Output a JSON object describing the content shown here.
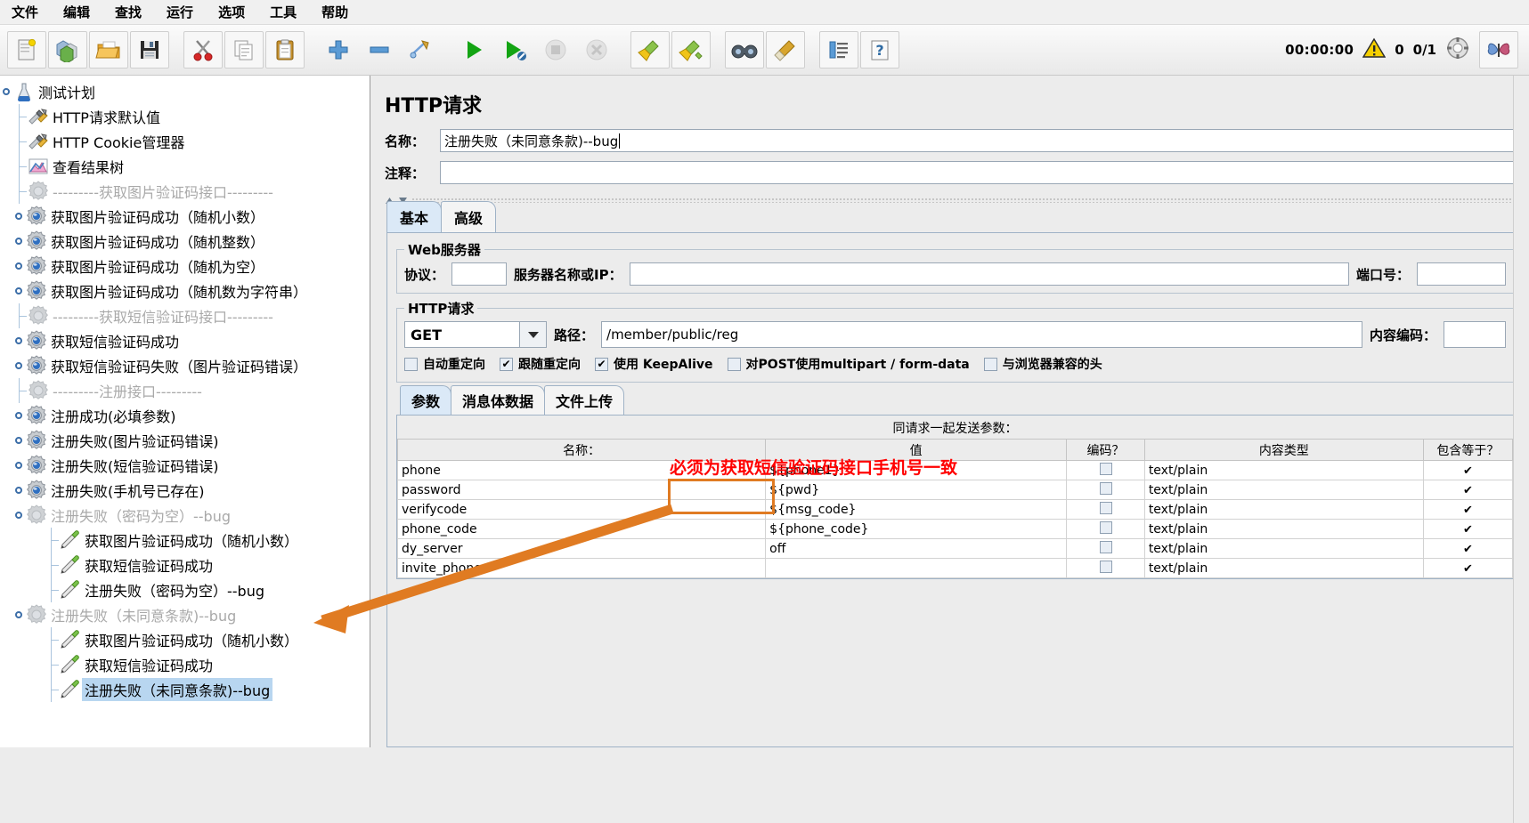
{
  "menu": {
    "items": [
      "文件",
      "编辑",
      "查找",
      "运行",
      "选项",
      "工具",
      "帮助"
    ]
  },
  "toolbar": {
    "buttons": [
      {
        "name": "new",
        "icon": "new-file-icon"
      },
      {
        "name": "templates",
        "icon": "templates-icon"
      },
      {
        "name": "open",
        "icon": "open-folder-icon"
      },
      {
        "name": "save",
        "icon": "save-disk-icon"
      },
      {
        "name": "cut",
        "icon": "scissors-icon"
      },
      {
        "name": "copy",
        "icon": "copy-icon"
      },
      {
        "name": "paste",
        "icon": "clipboard-icon"
      },
      {
        "name": "expand",
        "icon": "plus-icon"
      },
      {
        "name": "collapse",
        "icon": "minus-icon"
      },
      {
        "name": "toggle",
        "icon": "toggle-icon"
      },
      {
        "name": "start",
        "icon": "play-icon"
      },
      {
        "name": "start-no-pauses",
        "icon": "play-no-pause-icon"
      },
      {
        "name": "stop",
        "icon": "stop-icon"
      },
      {
        "name": "shutdown",
        "icon": "shutdown-icon"
      },
      {
        "name": "clear",
        "icon": "broom-icon"
      },
      {
        "name": "clear-all",
        "icon": "broom-all-icon"
      },
      {
        "name": "search",
        "icon": "binoculars-icon"
      },
      {
        "name": "reset-search",
        "icon": "eraser-icon"
      },
      {
        "name": "function-helper",
        "icon": "function-list-icon"
      },
      {
        "name": "help",
        "icon": "help-icon"
      }
    ],
    "status": {
      "elapsed": "00:00:00",
      "warning_count": "0",
      "threads": "0/1",
      "warning_icon": "warning-triangle-icon",
      "thread-icon": "thread-indicator-icon",
      "bug_icon": "butterfly-icon"
    }
  },
  "tree": {
    "nodes": [
      {
        "label": "测试计划",
        "depth": 0,
        "icon": "test-plan-icon",
        "handle": true,
        "disabled": false,
        "selected": false
      },
      {
        "label": "HTTP请求默认值",
        "depth": 1,
        "icon": "config-element-icon",
        "handle": false,
        "disabled": false,
        "selected": false
      },
      {
        "label": "HTTP Cookie管理器",
        "depth": 1,
        "icon": "config-element-icon",
        "handle": false,
        "disabled": false,
        "selected": false
      },
      {
        "label": "查看结果树",
        "depth": 1,
        "icon": "view-results-tree-icon",
        "handle": false,
        "disabled": false,
        "selected": false
      },
      {
        "label": "---------获取图片验证码接口---------",
        "depth": 1,
        "icon": "thread-group-disabled-icon",
        "handle": false,
        "disabled": true,
        "selected": false
      },
      {
        "label": "获取图片验证码成功（随机小数）",
        "depth": 1,
        "icon": "thread-group-icon",
        "handle": true,
        "disabled": false,
        "selected": false
      },
      {
        "label": "获取图片验证码成功（随机整数）",
        "depth": 1,
        "icon": "thread-group-icon",
        "handle": true,
        "disabled": false,
        "selected": false
      },
      {
        "label": "获取图片验证码成功（随机为空）",
        "depth": 1,
        "icon": "thread-group-icon",
        "handle": true,
        "disabled": false,
        "selected": false
      },
      {
        "label": "获取图片验证码成功（随机数为字符串）",
        "depth": 1,
        "icon": "thread-group-icon",
        "handle": true,
        "disabled": false,
        "selected": false
      },
      {
        "label": "---------获取短信验证码接口---------",
        "depth": 1,
        "icon": "thread-group-disabled-icon",
        "handle": false,
        "disabled": true,
        "selected": false
      },
      {
        "label": "获取短信验证码成功",
        "depth": 1,
        "icon": "thread-group-icon",
        "handle": true,
        "disabled": false,
        "selected": false
      },
      {
        "label": "获取短信验证码失败（图片验证码错误）",
        "depth": 1,
        "icon": "thread-group-icon",
        "handle": true,
        "disabled": false,
        "selected": false
      },
      {
        "label": "---------注册接口---------",
        "depth": 1,
        "icon": "thread-group-disabled-icon",
        "handle": false,
        "disabled": true,
        "selected": false
      },
      {
        "label": "注册成功(必填参数)",
        "depth": 1,
        "icon": "thread-group-icon",
        "handle": true,
        "disabled": false,
        "selected": false
      },
      {
        "label": "注册失败(图片验证码错误)",
        "depth": 1,
        "icon": "thread-group-icon",
        "handle": true,
        "disabled": false,
        "selected": false
      },
      {
        "label": "注册失败(短信验证码错误)",
        "depth": 1,
        "icon": "thread-group-icon",
        "handle": true,
        "disabled": false,
        "selected": false
      },
      {
        "label": "注册失败(手机号已存在)",
        "depth": 1,
        "icon": "thread-group-icon",
        "handle": true,
        "disabled": false,
        "selected": false
      },
      {
        "label": "注册失败（密码为空）--bug",
        "depth": 1,
        "icon": "thread-group-disabled-icon",
        "handle": true,
        "disabled": true,
        "selected": false
      },
      {
        "label": "获取图片验证码成功（随机小数）",
        "depth": 2,
        "icon": "http-sampler-icon",
        "handle": false,
        "disabled": false,
        "selected": false
      },
      {
        "label": "获取短信验证码成功",
        "depth": 2,
        "icon": "http-sampler-icon",
        "handle": false,
        "disabled": false,
        "selected": false
      },
      {
        "label": "注册失败（密码为空）--bug",
        "depth": 2,
        "icon": "http-sampler-icon",
        "handle": false,
        "disabled": false,
        "selected": false
      },
      {
        "label": "注册失败（未同意条款)--bug",
        "depth": 1,
        "icon": "thread-group-disabled-icon",
        "handle": true,
        "disabled": true,
        "selected": false
      },
      {
        "label": "获取图片验证码成功（随机小数）",
        "depth": 2,
        "icon": "http-sampler-icon",
        "handle": false,
        "disabled": false,
        "selected": false
      },
      {
        "label": "获取短信验证码成功",
        "depth": 2,
        "icon": "http-sampler-icon",
        "handle": false,
        "disabled": false,
        "selected": false
      },
      {
        "label": "注册失败（未同意条款)--bug",
        "depth": 2,
        "icon": "http-sampler-icon",
        "handle": false,
        "disabled": false,
        "selected": true
      }
    ]
  },
  "editor": {
    "title": "HTTP请求",
    "name_label": "名称：",
    "name_value": "注册失败（未同意条款)--bug",
    "comment_label": "注释：",
    "comment_value": "",
    "tabs": [
      {
        "label": "基本",
        "active": true
      },
      {
        "label": "高级",
        "active": false
      }
    ],
    "web_server": {
      "legend": "Web服务器",
      "protocol_label": "协议：",
      "protocol_value": "",
      "server_label": "服务器名称或IP：",
      "server_value": "",
      "port_label": "端口号：",
      "port_value": ""
    },
    "http_request": {
      "legend": "HTTP请求",
      "method": "GET",
      "path_label": "路径：",
      "path_value": "/member/public/reg",
      "encoding_label": "内容编码：",
      "encoding_value": "",
      "checkboxes": [
        {
          "label": "自动重定向",
          "checked": false
        },
        {
          "label": "跟随重定向",
          "checked": true
        },
        {
          "label": "使用 KeepAlive",
          "checked": true
        },
        {
          "label": "对POST使用multipart / form-data",
          "checked": false
        },
        {
          "label": "与浏览器兼容的头",
          "checked": false
        }
      ]
    },
    "sub_tabs": [
      {
        "label": "参数",
        "active": true
      },
      {
        "label": "消息体数据",
        "active": false
      },
      {
        "label": "文件上传",
        "active": false
      }
    ],
    "params_table": {
      "caption": "同请求一起发送参数：",
      "columns": [
        "名称：",
        "值",
        "编码？",
        "内容类型",
        "包含等于？"
      ],
      "rows": [
        {
          "name": "phone",
          "value": "${phone1}",
          "encode": false,
          "content_type": "text/plain",
          "include_equals": true
        },
        {
          "name": "password",
          "value": "${pwd}",
          "encode": false,
          "content_type": "text/plain",
          "include_equals": true
        },
        {
          "name": "verifycode",
          "value": "${msg_code}",
          "encode": false,
          "content_type": "text/plain",
          "include_equals": true
        },
        {
          "name": "phone_code",
          "value": "${phone_code}",
          "encode": false,
          "content_type": "text/plain",
          "include_equals": true
        },
        {
          "name": "dy_server",
          "value": "off",
          "encode": false,
          "content_type": "text/plain",
          "include_equals": true
        },
        {
          "name": "invite_phone",
          "value": "",
          "encode": false,
          "content_type": "text/plain",
          "include_equals": true
        }
      ]
    }
  },
  "annotations": {
    "red_note": "必须为获取短信验证码接口手机号一致",
    "highlight_color": "#e07b22",
    "red_color": "#ff0000"
  }
}
